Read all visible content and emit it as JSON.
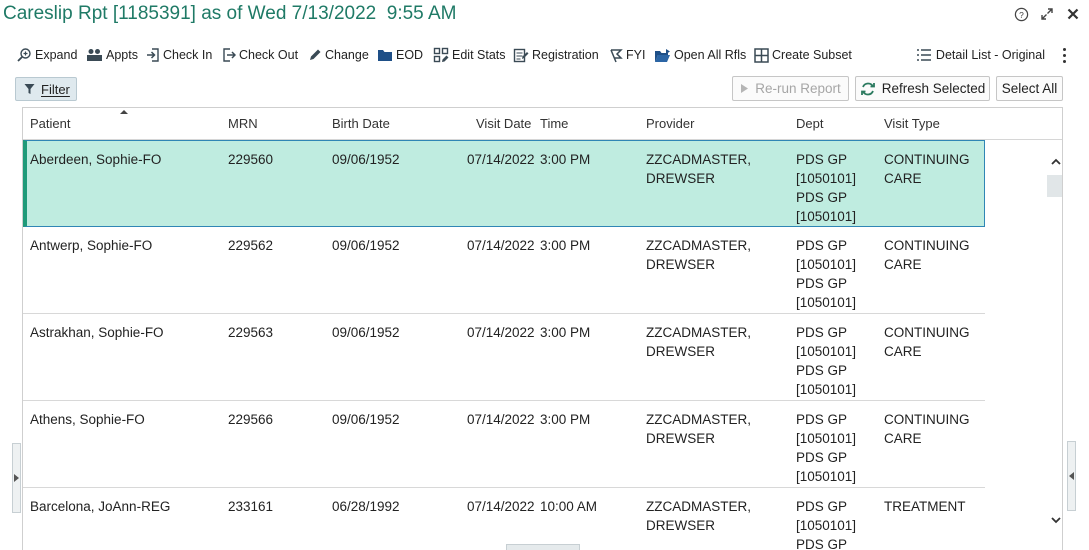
{
  "window": {
    "title": "Careslip Rpt [1185391] as of Wed 7/13/2022  9:55 AM",
    "help_icon": "help-circle-icon",
    "expand_icon": "expand-diagonal-icon",
    "close_icon": "close-icon"
  },
  "toolbar": {
    "items": [
      {
        "label": "Expand",
        "icon": "search-plus-icon"
      },
      {
        "label": "Appts",
        "icon": "people-icon"
      },
      {
        "label": "Check In",
        "icon": "check-in-icon"
      },
      {
        "label": "Check Out",
        "icon": "check-out-icon"
      },
      {
        "label": "Change",
        "icon": "pencil-icon"
      },
      {
        "label": "EOD",
        "icon": "folder-icon"
      },
      {
        "label": "Edit Stats",
        "icon": "edit-stats-icon"
      },
      {
        "label": "Registration",
        "icon": "registration-icon"
      },
      {
        "label": "FYI",
        "icon": "flag-icon"
      },
      {
        "label": "Open All Rfls",
        "icon": "open-folder-icon"
      },
      {
        "label": "Create Subset",
        "icon": "grid-icon"
      }
    ],
    "view_label": "Detail List - Original",
    "view_icon": "list-icon",
    "more_icon": "kebab-menu-icon"
  },
  "actions": {
    "filter_label": "Filter",
    "rerun_label": "Re-run Report",
    "refresh_label": "Refresh Selected",
    "select_all_label": "Select All"
  },
  "table": {
    "columns": [
      "Patient",
      "MRN",
      "Birth Date",
      "Visit Date",
      "Time",
      "Provider",
      "Dept",
      "Visit Type"
    ],
    "rows": [
      {
        "patient": "Aberdeen, Sophie-FO",
        "mrn": "229560",
        "birth": "09/06/1952",
        "visit_date": "07/14/2022",
        "time": "3:00 PM",
        "provider": "ZZCADMASTER, DREWSER",
        "dept": "PDS GP [1050101] PDS GP [1050101]",
        "visit_type": "CONTINUING CARE",
        "selected": true
      },
      {
        "patient": "Antwerp, Sophie-FO",
        "mrn": "229562",
        "birth": "09/06/1952",
        "visit_date": "07/14/2022",
        "time": "3:00 PM",
        "provider": "ZZCADMASTER, DREWSER",
        "dept": "PDS GP [1050101] PDS GP [1050101]",
        "visit_type": "CONTINUING CARE",
        "selected": false
      },
      {
        "patient": "Astrakhan, Sophie-FO",
        "mrn": "229563",
        "birth": "09/06/1952",
        "visit_date": "07/14/2022",
        "time": "3:00 PM",
        "provider": "ZZCADMASTER, DREWSER",
        "dept": "PDS GP [1050101] PDS GP [1050101]",
        "visit_type": "CONTINUING CARE",
        "selected": false
      },
      {
        "patient": "Athens, Sophie-FO",
        "mrn": "229566",
        "birth": "09/06/1952",
        "visit_date": "07/14/2022",
        "time": "3:00 PM",
        "provider": "ZZCADMASTER, DREWSER",
        "dept": "PDS GP [1050101] PDS GP [1050101]",
        "visit_type": "CONTINUING CARE",
        "selected": false
      },
      {
        "patient": "Barcelona, JoAnn-REG",
        "mrn": "233161",
        "birth": "06/28/1992",
        "visit_date": "07/14/2022",
        "time": "10:00 AM",
        "provider": "ZZCADMASTER, DREWSER",
        "dept": "PDS GP [1050101] PDS GP",
        "visit_type": "TREATMENT",
        "selected": false
      }
    ]
  },
  "colors": {
    "title": "#1f7a66",
    "selected_row": "#bfece0",
    "selected_accent": "#1f9a79"
  }
}
